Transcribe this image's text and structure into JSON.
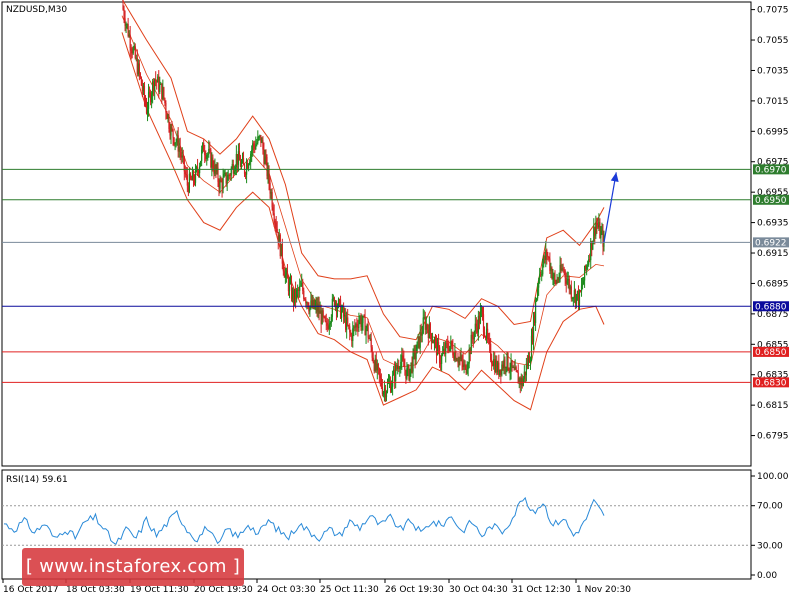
{
  "chart_data": [
    {
      "type": "candlestick",
      "title": "NZDUSD,M30",
      "ylim": [
        0.6775,
        0.708
      ],
      "y_ticks": [
        "0.7075",
        "0.7055",
        "0.7035",
        "0.7015",
        "0.6995",
        "0.6975",
        "0.6955",
        "0.6935",
        "0.6915",
        "0.6895",
        "0.6875",
        "0.6855",
        "0.6835",
        "0.6815",
        "0.6795"
      ],
      "x_ticks": [
        "16 Oct 2017",
        "18 Oct 03:30",
        "19 Oct 11:30",
        "20 Oct 19:30",
        "24 Oct 03:30",
        "25 Oct 11:30",
        "26 Oct 19:30",
        "30 Oct 04:30",
        "31 Oct 12:30",
        "1 Nov 20:30"
      ],
      "close_path": [
        [
          0,
          0.7078
        ],
        [
          1,
          0.7055
        ],
        [
          2,
          0.7035
        ],
        [
          3,
          0.701
        ],
        [
          4,
          0.703
        ],
        [
          5,
          0.702
        ],
        [
          6,
          0.6995
        ],
        [
          7,
          0.6985
        ],
        [
          8,
          0.696
        ],
        [
          9,
          0.6965
        ],
        [
          10,
          0.6985
        ],
        [
          11,
          0.6975
        ],
        [
          12,
          0.696
        ],
        [
          13,
          0.6965
        ],
        [
          14,
          0.6978
        ],
        [
          15,
          0.697
        ],
        [
          16,
          0.6985
        ],
        [
          17,
          0.699
        ],
        [
          18,
          0.6962
        ],
        [
          19,
          0.693
        ],
        [
          20,
          0.69
        ],
        [
          21,
          0.6885
        ],
        [
          22,
          0.6892
        ],
        [
          23,
          0.688
        ],
        [
          24,
          0.6878
        ],
        [
          25,
          0.6865
        ],
        [
          26,
          0.6885
        ],
        [
          27,
          0.6875
        ],
        [
          28,
          0.686
        ],
        [
          29,
          0.6872
        ],
        [
          30,
          0.6865
        ],
        [
          31,
          0.684
        ],
        [
          32,
          0.6825
        ],
        [
          33,
          0.683
        ],
        [
          34,
          0.6845
        ],
        [
          35,
          0.6835
        ],
        [
          36,
          0.685
        ],
        [
          37,
          0.687
        ],
        [
          38,
          0.686
        ],
        [
          39,
          0.6845
        ],
        [
          40,
          0.6855
        ],
        [
          41,
          0.6848
        ],
        [
          42,
          0.6838
        ],
        [
          43,
          0.6862
        ],
        [
          44,
          0.6875
        ],
        [
          45,
          0.685
        ],
        [
          46,
          0.6838
        ],
        [
          47,
          0.6845
        ],
        [
          48,
          0.6835
        ],
        [
          49,
          0.683
        ],
        [
          50,
          0.685
        ],
        [
          51,
          0.69
        ],
        [
          52,
          0.6915
        ],
        [
          53,
          0.6895
        ],
        [
          54,
          0.6905
        ],
        [
          55,
          0.689
        ],
        [
          56,
          0.6885
        ],
        [
          57,
          0.691
        ],
        [
          58,
          0.6935
        ],
        [
          59,
          0.6922
        ]
      ],
      "bands_upper_path": [
        [
          0,
          0.7082
        ],
        [
          3,
          0.7055
        ],
        [
          6,
          0.703
        ],
        [
          8,
          0.6995
        ],
        [
          10,
          0.699
        ],
        [
          12,
          0.698
        ],
        [
          14,
          0.699
        ],
        [
          16,
          0.7005
        ],
        [
          18,
          0.699
        ],
        [
          20,
          0.696
        ],
        [
          22,
          0.6915
        ],
        [
          24,
          0.69
        ],
        [
          26,
          0.6898
        ],
        [
          28,
          0.6898
        ],
        [
          30,
          0.69
        ],
        [
          32,
          0.6875
        ],
        [
          34,
          0.686
        ],
        [
          36,
          0.6858
        ],
        [
          38,
          0.688
        ],
        [
          40,
          0.6878
        ],
        [
          42,
          0.6872
        ],
        [
          44,
          0.6885
        ],
        [
          46,
          0.688
        ],
        [
          48,
          0.6868
        ],
        [
          50,
          0.687
        ],
        [
          52,
          0.6925
        ],
        [
          54,
          0.693
        ],
        [
          56,
          0.692
        ],
        [
          58,
          0.6935
        ],
        [
          59,
          0.6945
        ]
      ],
      "bands_lower_path": [
        [
          0,
          0.706
        ],
        [
          3,
          0.701
        ],
        [
          6,
          0.6975
        ],
        [
          8,
          0.695
        ],
        [
          10,
          0.6935
        ],
        [
          12,
          0.693
        ],
        [
          14,
          0.6945
        ],
        [
          16,
          0.6955
        ],
        [
          18,
          0.6945
        ],
        [
          20,
          0.6905
        ],
        [
          22,
          0.688
        ],
        [
          24,
          0.6862
        ],
        [
          26,
          0.6858
        ],
        [
          28,
          0.685
        ],
        [
          30,
          0.6845
        ],
        [
          32,
          0.6815
        ],
        [
          34,
          0.682
        ],
        [
          36,
          0.6825
        ],
        [
          38,
          0.684
        ],
        [
          40,
          0.6835
        ],
        [
          42,
          0.6825
        ],
        [
          44,
          0.6838
        ],
        [
          46,
          0.6828
        ],
        [
          48,
          0.6818
        ],
        [
          50,
          0.6812
        ],
        [
          52,
          0.685
        ],
        [
          54,
          0.687
        ],
        [
          56,
          0.6878
        ],
        [
          58,
          0.688
        ],
        [
          59,
          0.6868
        ]
      ],
      "horizontal_levels": [
        {
          "label": "0.6970",
          "value": 0.697,
          "color": "#2e7d2e"
        },
        {
          "label": "0.6950",
          "value": 0.695,
          "color": "#2e7d2e"
        },
        {
          "label": "0.6922",
          "value": 0.6922,
          "color": "#7a8a9a"
        },
        {
          "label": "0.6880",
          "value": 0.688,
          "color": "#0a0a9c"
        },
        {
          "label": "0.6850",
          "value": 0.685,
          "color": "#e02020"
        },
        {
          "label": "0.6830",
          "value": 0.683,
          "color": "#e02020"
        }
      ],
      "arrow": {
        "from": [
          59,
          0.6922
        ],
        "to": [
          60.5,
          0.6968
        ],
        "color": "#1a3ad8"
      }
    },
    {
      "type": "line",
      "title": "RSI(14) 59.61",
      "ylim": [
        0,
        100
      ],
      "y_ticks": [
        "100.00",
        "70.00",
        "30.00",
        "0.00"
      ],
      "reference_levels": [
        70,
        30
      ],
      "values_path": [
        [
          0,
          52
        ],
        [
          1,
          46
        ],
        [
          2,
          55
        ],
        [
          3,
          43
        ],
        [
          4,
          52
        ],
        [
          5,
          36
        ],
        [
          6,
          47
        ],
        [
          7,
          38
        ],
        [
          8,
          54
        ],
        [
          9,
          58
        ],
        [
          10,
          44
        ],
        [
          11,
          30
        ],
        [
          12,
          46
        ],
        [
          13,
          37
        ],
        [
          14,
          56
        ],
        [
          15,
          40
        ],
        [
          16,
          52
        ],
        [
          17,
          63
        ],
        [
          18,
          46
        ],
        [
          19,
          36
        ],
        [
          20,
          49
        ],
        [
          21,
          29
        ],
        [
          22,
          47
        ],
        [
          23,
          38
        ],
        [
          24,
          52
        ],
        [
          25,
          41
        ],
        [
          26,
          55
        ],
        [
          27,
          45
        ],
        [
          28,
          38
        ],
        [
          29,
          52
        ],
        [
          30,
          44
        ],
        [
          31,
          38
        ],
        [
          32,
          46
        ],
        [
          33,
          40
        ],
        [
          34,
          54
        ],
        [
          35,
          48
        ],
        [
          36,
          60
        ],
        [
          37,
          50
        ],
        [
          38,
          58
        ],
        [
          39,
          46
        ],
        [
          40,
          55
        ],
        [
          41,
          42
        ],
        [
          42,
          54
        ],
        [
          43,
          50
        ],
        [
          44,
          60
        ],
        [
          45,
          44
        ],
        [
          46,
          54
        ],
        [
          47,
          40
        ],
        [
          48,
          50
        ],
        [
          49,
          44
        ],
        [
          50,
          58
        ],
        [
          51,
          78
        ],
        [
          52,
          62
        ],
        [
          53,
          74
        ],
        [
          54,
          50
        ],
        [
          55,
          58
        ],
        [
          56,
          40
        ],
        [
          57,
          52
        ],
        [
          58,
          74
        ],
        [
          59,
          60
        ]
      ]
    }
  ],
  "watermark": {
    "text": "[ www.instaforex.com ]"
  }
}
